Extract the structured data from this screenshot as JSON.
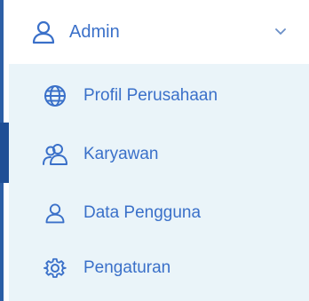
{
  "menu": {
    "group": {
      "label": "Admin",
      "icon": "user-icon",
      "expanded": true
    },
    "items": [
      {
        "label": "Profil Perusahaan",
        "icon": "globe-icon"
      },
      {
        "label": "Karyawan",
        "icon": "users-icon"
      },
      {
        "label": "Data Pengguna",
        "icon": "user-icon"
      },
      {
        "label": "Pengaturan",
        "icon": "gear-icon"
      }
    ]
  },
  "colors": {
    "accent": "#3a70c9",
    "rail": "#2d5fa6",
    "submenu_bg": "#eaf4f9"
  }
}
